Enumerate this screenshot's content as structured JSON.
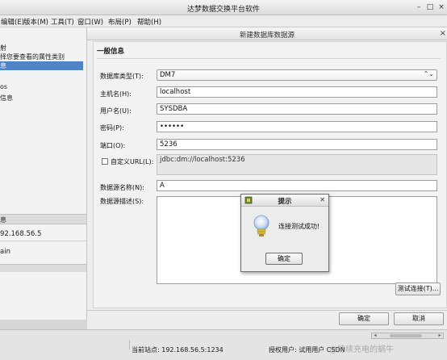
{
  "app": {
    "title": "达梦数据交换平台软件"
  },
  "menu": [
    {
      "label": "编辑(E)"
    },
    {
      "label": "版本(M)"
    },
    {
      "label": "工具(T)"
    },
    {
      "label": "窗口(W)"
    },
    {
      "label": "布局(P)"
    },
    {
      "label": "帮助(H)"
    }
  ],
  "left_panel": {
    "items": [
      "射",
      "择您要查看的属性类别",
      "息",
      "os",
      "信息",
      "息",
      "92.168.56.5",
      "ain"
    ]
  },
  "dialog": {
    "title": "新建数据库数据源",
    "section_title": "一般信息",
    "fields": {
      "db_type": {
        "label": "数据库类型(T):",
        "value": "DM7"
      },
      "host": {
        "label": "主机名(H):",
        "value": "localhost"
      },
      "user": {
        "label": "用户名(U):",
        "value": "SYSDBA"
      },
      "password": {
        "label": "密码(P):",
        "value": "••••••"
      },
      "port": {
        "label": "端口(O):",
        "value": "5236"
      },
      "custom_url": {
        "label": "自定义URL(L):",
        "value": "jdbc:dm://localhost:5236",
        "checked": false
      },
      "ds_name": {
        "label": "数据源名称(N):",
        "value": "A"
      },
      "ds_desc": {
        "label": "数据源描述(S):",
        "value": ""
      }
    },
    "buttons": {
      "test_connection": "测试连接(T)...",
      "ok": "确定",
      "cancel": "取消"
    }
  },
  "prompt": {
    "title": "提示",
    "message": "连接测试成功!",
    "ok": "确定"
  },
  "statusbar": {
    "current_site": "当前站点: 192.168.56.5:1234",
    "license": "授权用户: 试用用户 CSDN",
    "watermark": "@持续充电的蜗牛"
  }
}
